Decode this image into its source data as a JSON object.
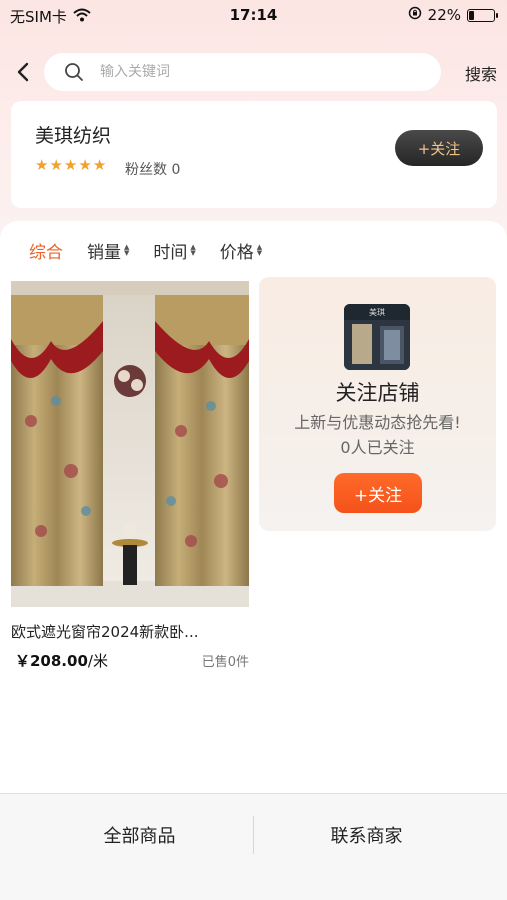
{
  "status_bar": {
    "carrier": "无SIM卡",
    "time": "17:14",
    "battery": "22%",
    "battery_level": 0.22
  },
  "search": {
    "placeholder": "输入关键词",
    "button": "搜索"
  },
  "shop": {
    "name": "美琪纺织",
    "rating_stars": 5,
    "fans": "粉丝数 0",
    "follow_button": "+关注"
  },
  "sort": {
    "items": [
      {
        "label": "综合",
        "active": true
      },
      {
        "label": "销量",
        "active": false
      },
      {
        "label": "时间",
        "active": false
      },
      {
        "label": "价格",
        "active": false
      }
    ]
  },
  "product": {
    "title": "欧式遮光窗帘2024新款卧...",
    "price": "￥208.00",
    "unit": "/米",
    "sold": "已售0件"
  },
  "promo": {
    "avatar_text": "美琪",
    "title": "关注店铺",
    "subtitle": "上新与优惠动态抢先看!",
    "count": "0人已关注",
    "follow_button": "+关注"
  },
  "bottom": {
    "all_products": "全部商品",
    "contact": "联系商家"
  },
  "colors": {
    "accent": "#e8642c",
    "button_orange": "#f65a1f",
    "star": "#f0a22c",
    "follow_text": "#f3c386"
  }
}
